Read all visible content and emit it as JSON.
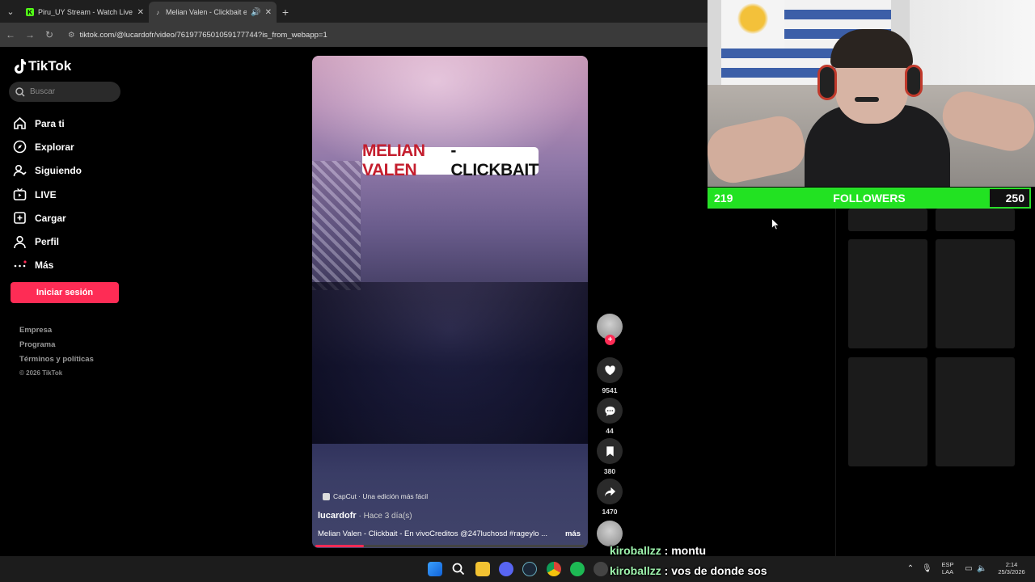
{
  "browser": {
    "tabs": [
      {
        "title": "Piru_UY Stream - Watch Live on",
        "favicon_letter": "K",
        "favicon_color": "#53fc18",
        "active": false
      },
      {
        "title": "Melian Valen - Clickbait en",
        "favicon_letter": "♪",
        "favicon_color": "#ffffff",
        "active": true
      }
    ],
    "url": "tiktok.com/@lucardofr/video/7619776501059177744?is_from_webapp=1"
  },
  "sidebar": {
    "logo": "TikTok",
    "search_placeholder": "Buscar",
    "nav": [
      {
        "label": "Para ti",
        "icon": "home-icon"
      },
      {
        "label": "Explorar",
        "icon": "compass-icon"
      },
      {
        "label": "Siguiendo",
        "icon": "following-icon"
      },
      {
        "label": "LIVE",
        "icon": "live-icon"
      },
      {
        "label": "Cargar",
        "icon": "upload-icon"
      },
      {
        "label": "Perfil",
        "icon": "profile-icon"
      },
      {
        "label": "Más",
        "icon": "more-icon"
      }
    ],
    "login_label": "Iniciar sesión",
    "footer": {
      "company": "Empresa",
      "program": "Programa",
      "terms": "Términos y políticas",
      "copyright": "© 2026 TikTok"
    }
  },
  "video": {
    "overlay_title_a": "MELIAN VALEN",
    "overlay_title_b": " - CLICKBAIT",
    "capcut_label": "CapCut · Una edición más fácil",
    "author": "lucardofr",
    "posted": " · Hace 3 día(s)",
    "description": "Melian Valen - Clickbait - En vivoCreditos @247luchosd #rageylo ...",
    "more_label": "más",
    "progress": 0.18
  },
  "actions": {
    "likes": "9541",
    "comments": "44",
    "saves": "380",
    "shares": "1470"
  },
  "stream_overlay": {
    "followers_current": "219",
    "followers_label": "FOLLOWERS",
    "followers_goal": "250",
    "progress": 0.876
  },
  "chat": [
    {
      "user": "kiroballzz",
      "message": " : montu"
    },
    {
      "user": "kiroballzz",
      "message": " : vos de donde sos"
    }
  ],
  "taskbar": {
    "lang_top": "ESP",
    "lang_bottom": "LAA",
    "time": "2:14",
    "date": "25/3/2026"
  }
}
